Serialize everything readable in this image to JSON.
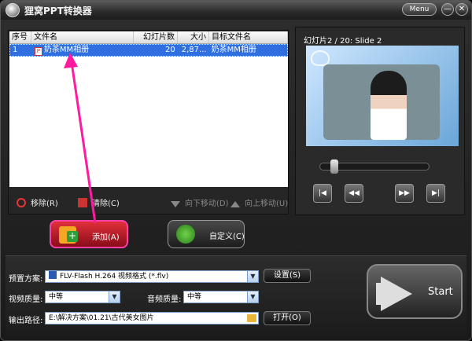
{
  "app": {
    "title": "狸窝PPT转换器",
    "menu_label": "Menu",
    "min_icon": "—",
    "close_icon": "✕"
  },
  "file_list": {
    "columns": [
      "序号",
      "文件名",
      "幻灯片数",
      "大小",
      "目标文件名"
    ],
    "rows": [
      {
        "index": "1",
        "file_name": "奶茶MM相册",
        "slides": "20",
        "size": "2,87...",
        "target_name": "奶茶MM相册"
      }
    ]
  },
  "list_toolbar": {
    "remove_label": "移除(R)",
    "clear_label": "清除(C)",
    "move_down_label": "向下移动(D)",
    "move_up_label": "向上移动(U)"
  },
  "preview": {
    "slide_label": "幻灯片2 / 20: Slide 2",
    "progress_fraction": 0.1,
    "buttons": [
      "prev-icon",
      "rewind-icon",
      "forward-icon",
      "next-icon"
    ]
  },
  "actions": {
    "add_label": "添加(A)",
    "custom_label": "自定义(C)"
  },
  "settings": {
    "preset_label": "预置方案:",
    "preset_value": "FLV-Flash H.264 视频格式 (*.flv)",
    "settings_button": "设置(S)",
    "video_quality_label": "视频质量:",
    "video_quality_value": "中等",
    "audio_quality_label": "音频质量:",
    "audio_quality_value": "中等",
    "output_path_label": "输出路径:",
    "output_path_value": "E:\\解决方案\\01.21\\古代美女图片",
    "open_button": "打开(O)"
  },
  "start": {
    "label": "Start"
  },
  "colors": {
    "highlight": "#ff1aa0",
    "selection": "#2f6fe0",
    "add_button": "#d0202e"
  }
}
